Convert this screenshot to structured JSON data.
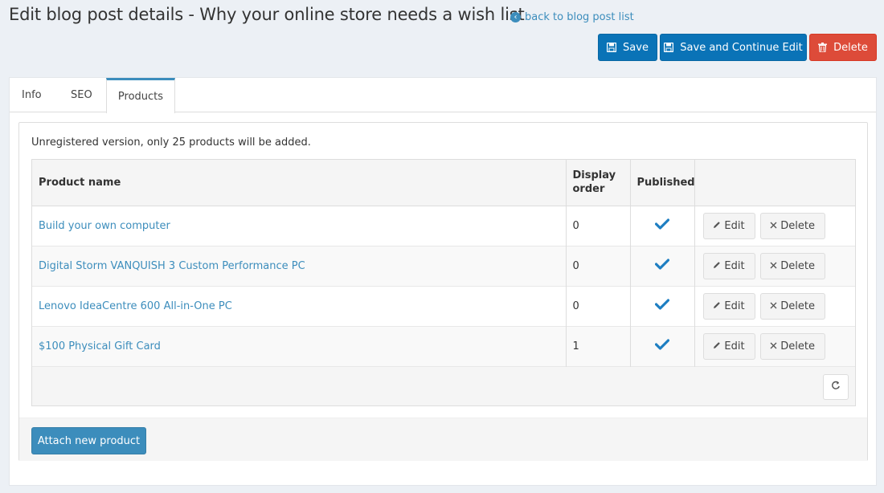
{
  "header": {
    "title": "Edit blog post details - Why your online store needs a wish list",
    "back_link": "back to blog post list"
  },
  "toolbar": {
    "save_label": "Save",
    "save_continue_label": "Save and Continue Edit",
    "delete_label": "Delete"
  },
  "tabs": [
    {
      "label": "Info"
    },
    {
      "label": "SEO"
    },
    {
      "label": "Products"
    }
  ],
  "active_tab": "Products",
  "products_panel": {
    "notice": "Unregistered version, only 25 products will be added.",
    "columns": {
      "name": "Product name",
      "display_order": "Display order",
      "published": "Published"
    },
    "rows": [
      {
        "name": "Build your own computer",
        "display_order": "0",
        "published": true,
        "edit_label": "Edit",
        "delete_label": "Delete"
      },
      {
        "name": "Digital Storm VANQUISH 3 Custom Performance PC",
        "display_order": "0",
        "published": true,
        "edit_label": "Edit",
        "delete_label": "Delete"
      },
      {
        "name": "Lenovo IdeaCentre 600 All-in-One PC",
        "display_order": "0",
        "published": true,
        "edit_label": "Edit",
        "delete_label": "Delete"
      },
      {
        "name": "$100 Physical Gift Card",
        "display_order": "1",
        "published": true,
        "edit_label": "Edit",
        "delete_label": "Delete"
      }
    ],
    "attach_label": "Attach new product"
  },
  "icons": {
    "save": "floppy-disk-icon",
    "delete": "trash-icon",
    "back": "arrow-circle-left-icon",
    "published": "check-icon",
    "edit": "pencil-icon",
    "row_delete": "times-icon",
    "refresh": "refresh-icon"
  },
  "colors": {
    "primary": "#0a73b7",
    "danger": "#dd4b39",
    "link": "#3c8dbc",
    "check": "#1f7fc2"
  }
}
